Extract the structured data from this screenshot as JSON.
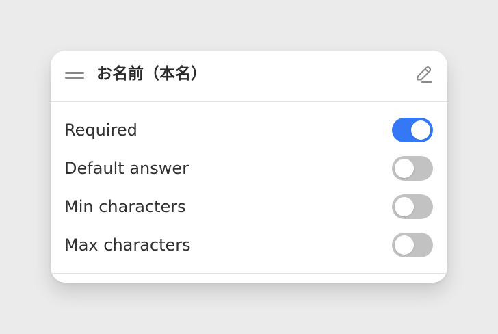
{
  "card": {
    "title": "お名前（本名）",
    "settings": [
      {
        "label": "Required",
        "enabled": true
      },
      {
        "label": "Default answer",
        "enabled": false
      },
      {
        "label": "Min characters",
        "enabled": false
      },
      {
        "label": "Max characters",
        "enabled": false
      }
    ]
  },
  "icons": {
    "drag": "drag-handle-icon",
    "edit": "pencil-edit-icon"
  },
  "colors": {
    "background": "#ebebeb",
    "card": "#ffffff",
    "toggle_on": "#3478f6",
    "toggle_off": "#c2c2c2",
    "text": "#303030"
  }
}
